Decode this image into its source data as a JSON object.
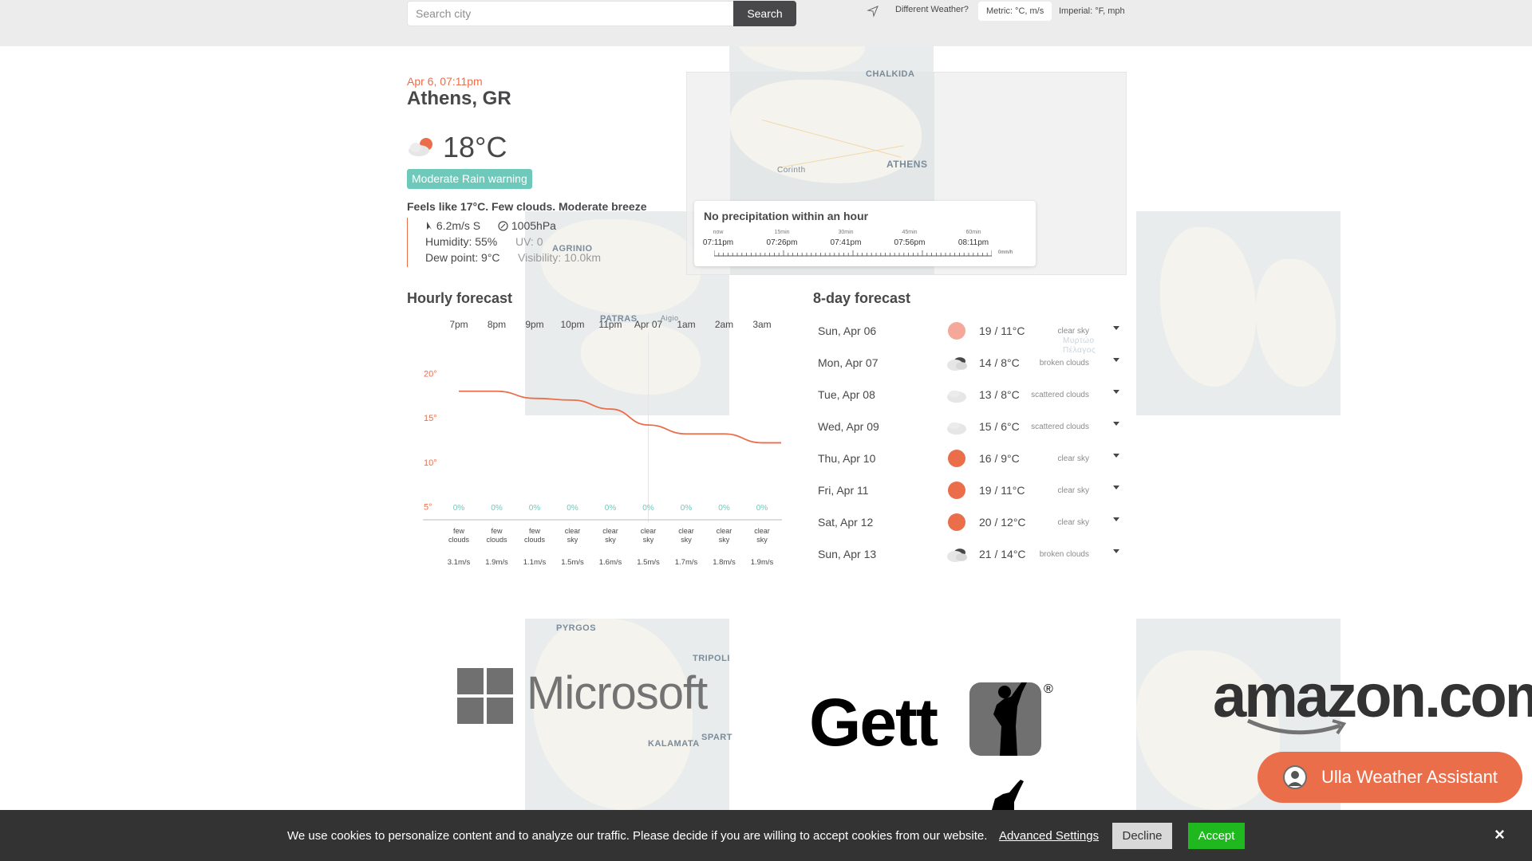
{
  "search": {
    "placeholder": "Search city",
    "button_label": "Search"
  },
  "header": {
    "different_weather": "Different Weather?",
    "unit_metric": "Metric: °C, m/s",
    "unit_imperial": "Imperial: °F, mph"
  },
  "current": {
    "datetime": "Apr 6, 07:11pm",
    "city": "Athens, GR",
    "temp": "18°C",
    "alert": "Moderate Rain warning",
    "summary": "Feels like 17°C. Few clouds. Moderate breeze",
    "wind": "6.2m/s S",
    "pressure": "1005hPa",
    "humidity": "Humidity:  55%",
    "uv": "UV: 0",
    "dew_point": "Dew point:  9°C",
    "visibility": "Visibility: 10.0km"
  },
  "map_labels": [
    "CHALKIDA",
    "ATHENS",
    "Corinth",
    "AGRINIO",
    "PATRAS",
    "Aigio",
    "PYRGOS",
    "TRIPOLI",
    "KALAMATA",
    "SPART",
    "Μυρτώο Πέλαγος"
  ],
  "precipitation": {
    "title": "No precipitation within an hour",
    "ticks": [
      {
        "label": "now",
        "time": "07:11pm"
      },
      {
        "label": "15min",
        "time": "07:26pm"
      },
      {
        "label": "30min",
        "time": "07:41pm"
      },
      {
        "label": "45min",
        "time": "07:56pm"
      },
      {
        "label": "60min",
        "time": "08:11pm"
      }
    ],
    "unit": "0mm/h"
  },
  "hourly": {
    "title": "Hourly forecast",
    "hours": [
      "7pm",
      "8pm",
      "9pm",
      "10pm",
      "11pm",
      "Apr 07",
      "1am",
      "2am",
      "3am"
    ],
    "precip": [
      "0%",
      "0%",
      "0%",
      "0%",
      "0%",
      "0%",
      "0%",
      "0%",
      "0%"
    ],
    "conditions": [
      [
        "few",
        "clouds"
      ],
      [
        "few",
        "clouds"
      ],
      [
        "few",
        "clouds"
      ],
      [
        "clear",
        "sky"
      ],
      [
        "clear",
        "sky"
      ],
      [
        "clear",
        "sky"
      ],
      [
        "clear",
        "sky"
      ],
      [
        "clear",
        "sky"
      ],
      [
        "clear",
        "sky"
      ]
    ],
    "wind": [
      "3.1m/s",
      "1.9m/s",
      "1.1m/s",
      "1.5m/s",
      "1.6m/s",
      "1.5m/s",
      "1.7m/s",
      "1.8m/s",
      "1.9m/s"
    ],
    "y_ticks": [
      "20°",
      "15°",
      "10°",
      "5°"
    ]
  },
  "chart_data": {
    "type": "line",
    "categories": [
      "7pm",
      "8pm",
      "9pm",
      "10pm",
      "11pm",
      "Apr 07",
      "1am",
      "2am",
      "3am"
    ],
    "series": [
      {
        "values": [
          18,
          18,
          17.2,
          17,
          16,
          14.2,
          13.2,
          13.2,
          12.2
        ]
      }
    ],
    "ylim": [
      3,
      23
    ],
    "y_ticks": [
      20,
      15,
      10,
      5
    ],
    "color": "#eb6e4b"
  },
  "daily": {
    "title": "8-day forecast",
    "days": [
      {
        "date": "Sun, Apr 06",
        "temp": "19 / 11°C",
        "desc": "clear sky",
        "icon": "sun-icon",
        "color": "#f5a79a"
      },
      {
        "date": "Mon, Apr 07",
        "temp": "14 / 8°C",
        "desc": "broken clouds",
        "icon": "broken-clouds-icon",
        "color": "#48484a"
      },
      {
        "date": "Tue, Apr 08",
        "temp": "13 / 8°C",
        "desc": "scattered clouds",
        "icon": "cloud-icon",
        "color": "#e3e3e3"
      },
      {
        "date": "Wed, Apr 09",
        "temp": "15 / 6°C",
        "desc": "scattered clouds",
        "icon": "cloud-icon",
        "color": "#e3e3e3"
      },
      {
        "date": "Thu, Apr 10",
        "temp": "16 / 9°C",
        "desc": "clear sky",
        "icon": "sun-icon",
        "color": "#eb6e4b"
      },
      {
        "date": "Fri, Apr 11",
        "temp": "19 / 11°C",
        "desc": "clear sky",
        "icon": "sun-icon",
        "color": "#eb6e4b"
      },
      {
        "date": "Sat, Apr 12",
        "temp": "20 / 12°C",
        "desc": "clear sky",
        "icon": "sun-icon",
        "color": "#eb6e4b"
      },
      {
        "date": "Sun, Apr 13",
        "temp": "21 / 14°C",
        "desc": "broken clouds",
        "icon": "broken-clouds-icon",
        "color": "#48484a"
      }
    ]
  },
  "sponsors": {
    "microsoft": "Microsoft",
    "gett": "Gett",
    "amazon": "amazon.com"
  },
  "assistant": {
    "label": "Ulla Weather Assistant"
  },
  "cookie": {
    "text": "We use cookies to personalize content and to analyze our traffic. Please decide if you are willing to accept cookies from our website.",
    "advanced": "Advanced Settings",
    "decline": "Decline",
    "accept": "Accept",
    "close": "×"
  }
}
